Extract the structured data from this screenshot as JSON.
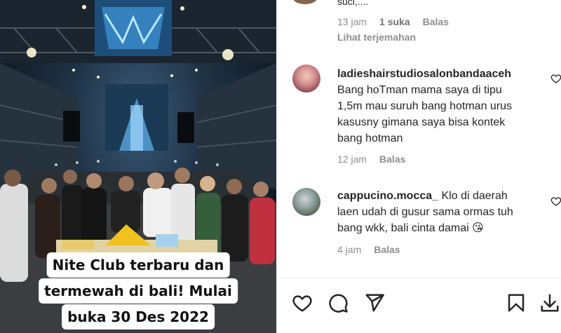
{
  "video": {
    "caption_lines": [
      "Nite Club terbaru dan",
      "termewah di bali! Mulai",
      "buka 30 Des 2022"
    ]
  },
  "comments": {
    "top_partial": {
      "text_cut": "suci,....",
      "time": "13 jam",
      "likes": "1 suka",
      "reply": "Balas",
      "see_translation": "Lihat terjemahan"
    },
    "items": [
      {
        "username": "ladieshairstudiosalonbandaaceh",
        "lines": [
          "Bang hoTman mama saya di tipu",
          "1,5m mau suruh bang hotman urus",
          "kasusny gimana saya bisa kontek",
          "bang hotman"
        ],
        "time": "12 jam",
        "reply": "Balas"
      },
      {
        "username": "cappucino.mocca_",
        "first_line_text": "Klo di daerah",
        "lines": [
          "laen udah di gusur sama ormas tuh",
          "bang wkk, bali cinta damai 😘"
        ],
        "time": "4 jam",
        "reply": "Balas"
      }
    ]
  },
  "actions": [
    "heart-icon",
    "comment-icon",
    "share-icon",
    "bookmark-icon",
    "download-icon"
  ],
  "colors": {
    "meta_grey": "#8e8e8e",
    "text": "#262626",
    "divider": "#efefef"
  }
}
